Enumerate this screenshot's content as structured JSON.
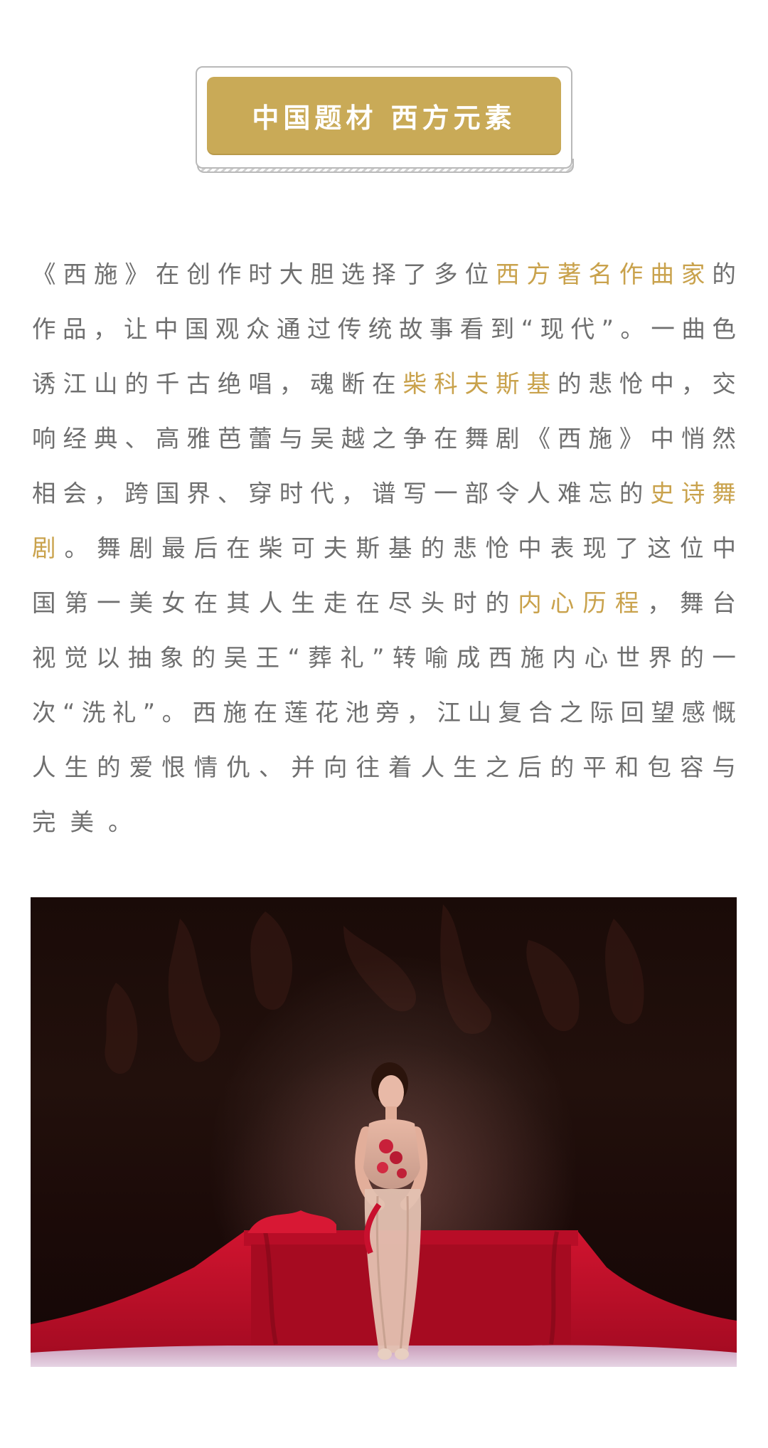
{
  "section": {
    "heading": "中国题材 西方元素"
  },
  "paragraph": {
    "lines": [
      [
        {
          "text": "《西施》在创作时大胆选择了多位"
        },
        {
          "text": "西方著名作曲家",
          "highlight": true
        },
        {
          "text": "的"
        }
      ],
      [
        {
          "text": "作品，让中国观众通过传统故事看到“现代”。一曲色"
        }
      ],
      [
        {
          "text": "诱江山的千古绝唱，魂断在"
        },
        {
          "text": "柴科夫斯基",
          "highlight": true
        },
        {
          "text": "的悲怆中，交"
        }
      ],
      [
        {
          "text": "响经典、高雅芭蕾与吴越之争在舞剧《西施》中悄然"
        }
      ],
      [
        {
          "text": "相会，跨国界、穿时代，谱写一部令人难忘的"
        },
        {
          "text": "史诗舞",
          "highlight": true
        }
      ],
      [
        {
          "text": "剧",
          "highlight": true
        },
        {
          "text": "。舞剧最后在柴可夫斯基的悲怆中表现了这位中"
        }
      ],
      [
        {
          "text": "国第一美女在其人生走在尽头时的"
        },
        {
          "text": "内心历程",
          "highlight": true
        },
        {
          "text": "，舞台"
        }
      ],
      [
        {
          "text": "视觉以抽象的吴王“葬礼”转喻成西施内心世界的一"
        }
      ],
      [
        {
          "text": "次“洗礼”。西施在莲花池旁，江山复合之际回望感慨"
        }
      ],
      [
        {
          "text": "人生的爱恨情仇、并向往着人生之后的平和包容与"
        }
      ],
      [
        {
          "text": "完美。"
        }
      ]
    ]
  },
  "colors": {
    "accent_gold": "#c9aa57",
    "highlight_text": "#c9a24c",
    "body_text": "#6f6f6f",
    "stage_red": "#c8102e"
  },
  "photo": {
    "icon": "ballet-stage-photo"
  }
}
